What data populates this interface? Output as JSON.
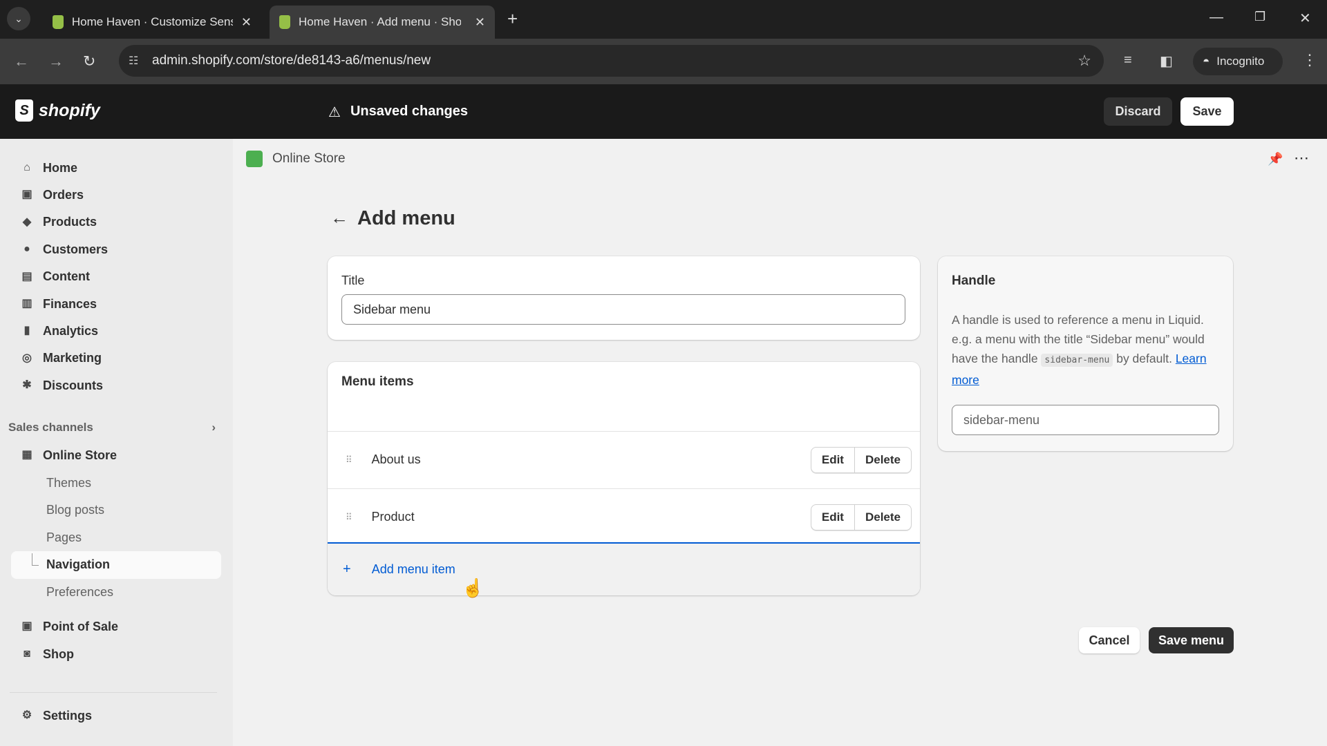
{
  "browser": {
    "tabs": [
      {
        "title": "Home Haven · Customize Sense"
      },
      {
        "title": "Home Haven · Add menu · Shop"
      }
    ],
    "url": "admin.shopify.com/store/de8143-a6/menus/new",
    "profile": "Incognito"
  },
  "topbar": {
    "logo": "shopify",
    "status": "Unsaved changes",
    "discard": "Discard",
    "save": "Save"
  },
  "sidebar": {
    "items": [
      {
        "label": "Home",
        "icon": "home-icon",
        "glyph": "⌂"
      },
      {
        "label": "Orders",
        "icon": "orders-icon",
        "glyph": "▣"
      },
      {
        "label": "Products",
        "icon": "tag-icon",
        "glyph": "◆"
      },
      {
        "label": "Customers",
        "icon": "person-icon",
        "glyph": "●"
      },
      {
        "label": "Content",
        "icon": "content-icon",
        "glyph": "▤"
      },
      {
        "label": "Finances",
        "icon": "bank-icon",
        "glyph": "▥"
      },
      {
        "label": "Analytics",
        "icon": "chart-icon",
        "glyph": "▮"
      },
      {
        "label": "Marketing",
        "icon": "target-icon",
        "glyph": "◎"
      },
      {
        "label": "Discounts",
        "icon": "discount-icon",
        "glyph": "✱"
      }
    ],
    "sales_channels": "Sales channels",
    "online_store": "Online Store",
    "sub_items": [
      "Themes",
      "Blog posts",
      "Pages",
      "Navigation",
      "Preferences"
    ],
    "active_sub": "Navigation",
    "pos": "Point of Sale",
    "shop": "Shop",
    "settings": "Settings"
  },
  "header": {
    "channel": "Online Store"
  },
  "page": {
    "title": "Add menu",
    "title_card": {
      "label": "Title",
      "value": "Sidebar menu"
    },
    "menu_items": {
      "heading": "Menu items",
      "items": [
        {
          "label": "About us"
        },
        {
          "label": "Product"
        }
      ],
      "edit": "Edit",
      "delete": "Delete",
      "add": "Add menu item"
    },
    "handle": {
      "heading": "Handle",
      "desc1": "A handle is used to reference a menu in Liquid. e.g. a menu with the title “Sidebar menu” would have the handle ",
      "code": "sidebar-menu",
      "desc2": " by default. ",
      "link": "Learn more",
      "value": "sidebar-menu"
    },
    "cancel": "Cancel",
    "save_menu": "Save menu"
  },
  "colors": {
    "accent": "#005bd3",
    "brand": "#95bf47"
  }
}
